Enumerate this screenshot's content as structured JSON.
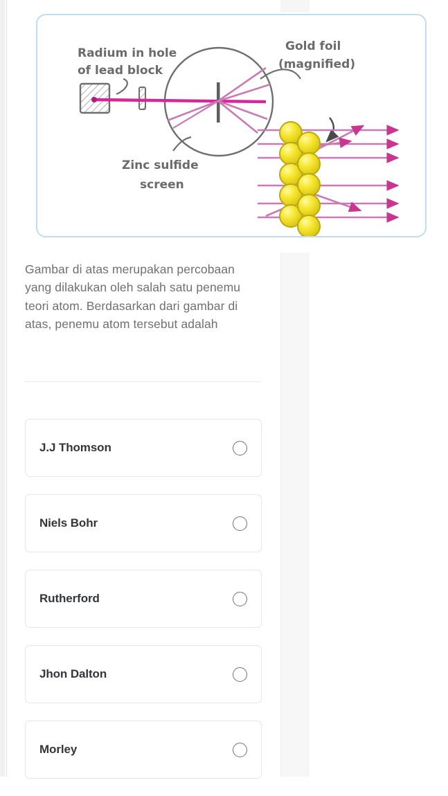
{
  "figure": {
    "alt_title": "rutherford-gold-foil-experiment-diagram",
    "card_border_color": "#c3dced",
    "beam_color": "#d6269a",
    "ray_color": "#c979b4",
    "atom_color": "#f5e53b",
    "labels": {
      "radium_line1": "Radium in hole",
      "radium_line2": "of lead block",
      "gold_foil_line1": "Gold foil",
      "gold_foil_line2": "(magnified)",
      "screen_line1": "Zinc sulfide",
      "screen_line2": "screen"
    }
  },
  "question": {
    "text": "Gambar di atas merupakan percobaan yang dilakukan oleh salah satu penemu teori atom. Berdasarkan dari gambar di atas, penemu atom tersebut adalah"
  },
  "options": [
    {
      "label": "J.J Thomson",
      "selected": false
    },
    {
      "label": "Niels Bohr",
      "selected": false
    },
    {
      "label": "Rutherford",
      "selected": false
    },
    {
      "label": "Jhon Dalton",
      "selected": false
    },
    {
      "label": "Morley",
      "selected": false
    }
  ]
}
